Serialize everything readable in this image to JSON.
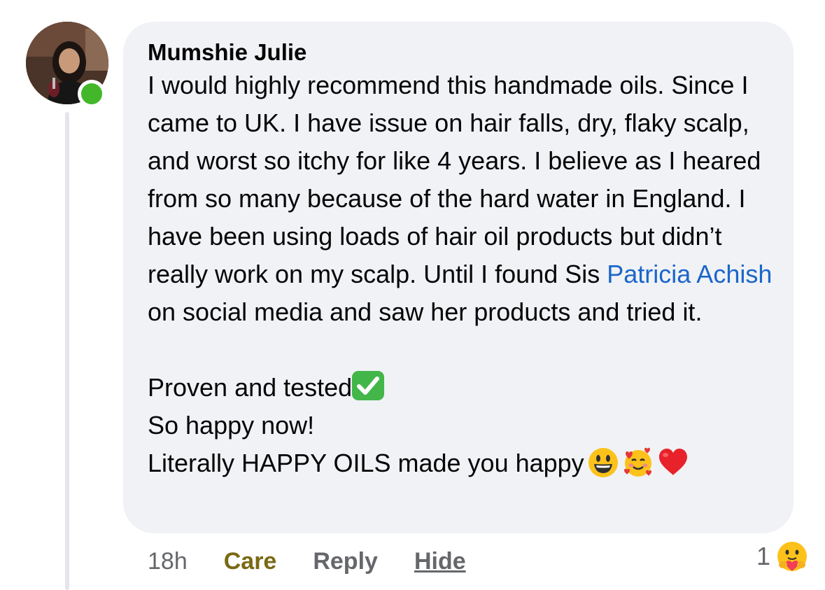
{
  "comment": {
    "author": "Mumshie Julie",
    "paragraph1_before_mention": "I would highly recommend this handmade oils. Since I came to UK. I have issue on hair falls, dry, flaky scalp, and worst so itchy for like 4 years. I believe as I heared from so many because of the hard water in England. I have been using loads of hair oil products but didn’t really work on my scalp. Until I found Sis ",
    "mention": "Patricia Achish",
    "paragraph1_after_mention": " on social media and saw her products and tried it.",
    "line_proven": "Proven and tested",
    "line_happy": "So happy now!",
    "line_literally": "Literally HAPPY OILS made you happy",
    "emojis": [
      "check-mark-button-emoji",
      "grinning-face-emoji",
      "smiling-face-with-hearts-emoji",
      "red-heart-emoji"
    ],
    "online_status": true
  },
  "actions": {
    "time": "18h",
    "care_label": "Care",
    "reply_label": "Reply",
    "hide_label": "Hide"
  },
  "reactions": {
    "count": "1",
    "icon": "care-reaction-icon"
  },
  "colors": {
    "bubble": "#f0f2f5",
    "mention": "#1b66c9",
    "care": "#7a6914",
    "secondary_text": "#65676b",
    "online": "#42b72a"
  }
}
